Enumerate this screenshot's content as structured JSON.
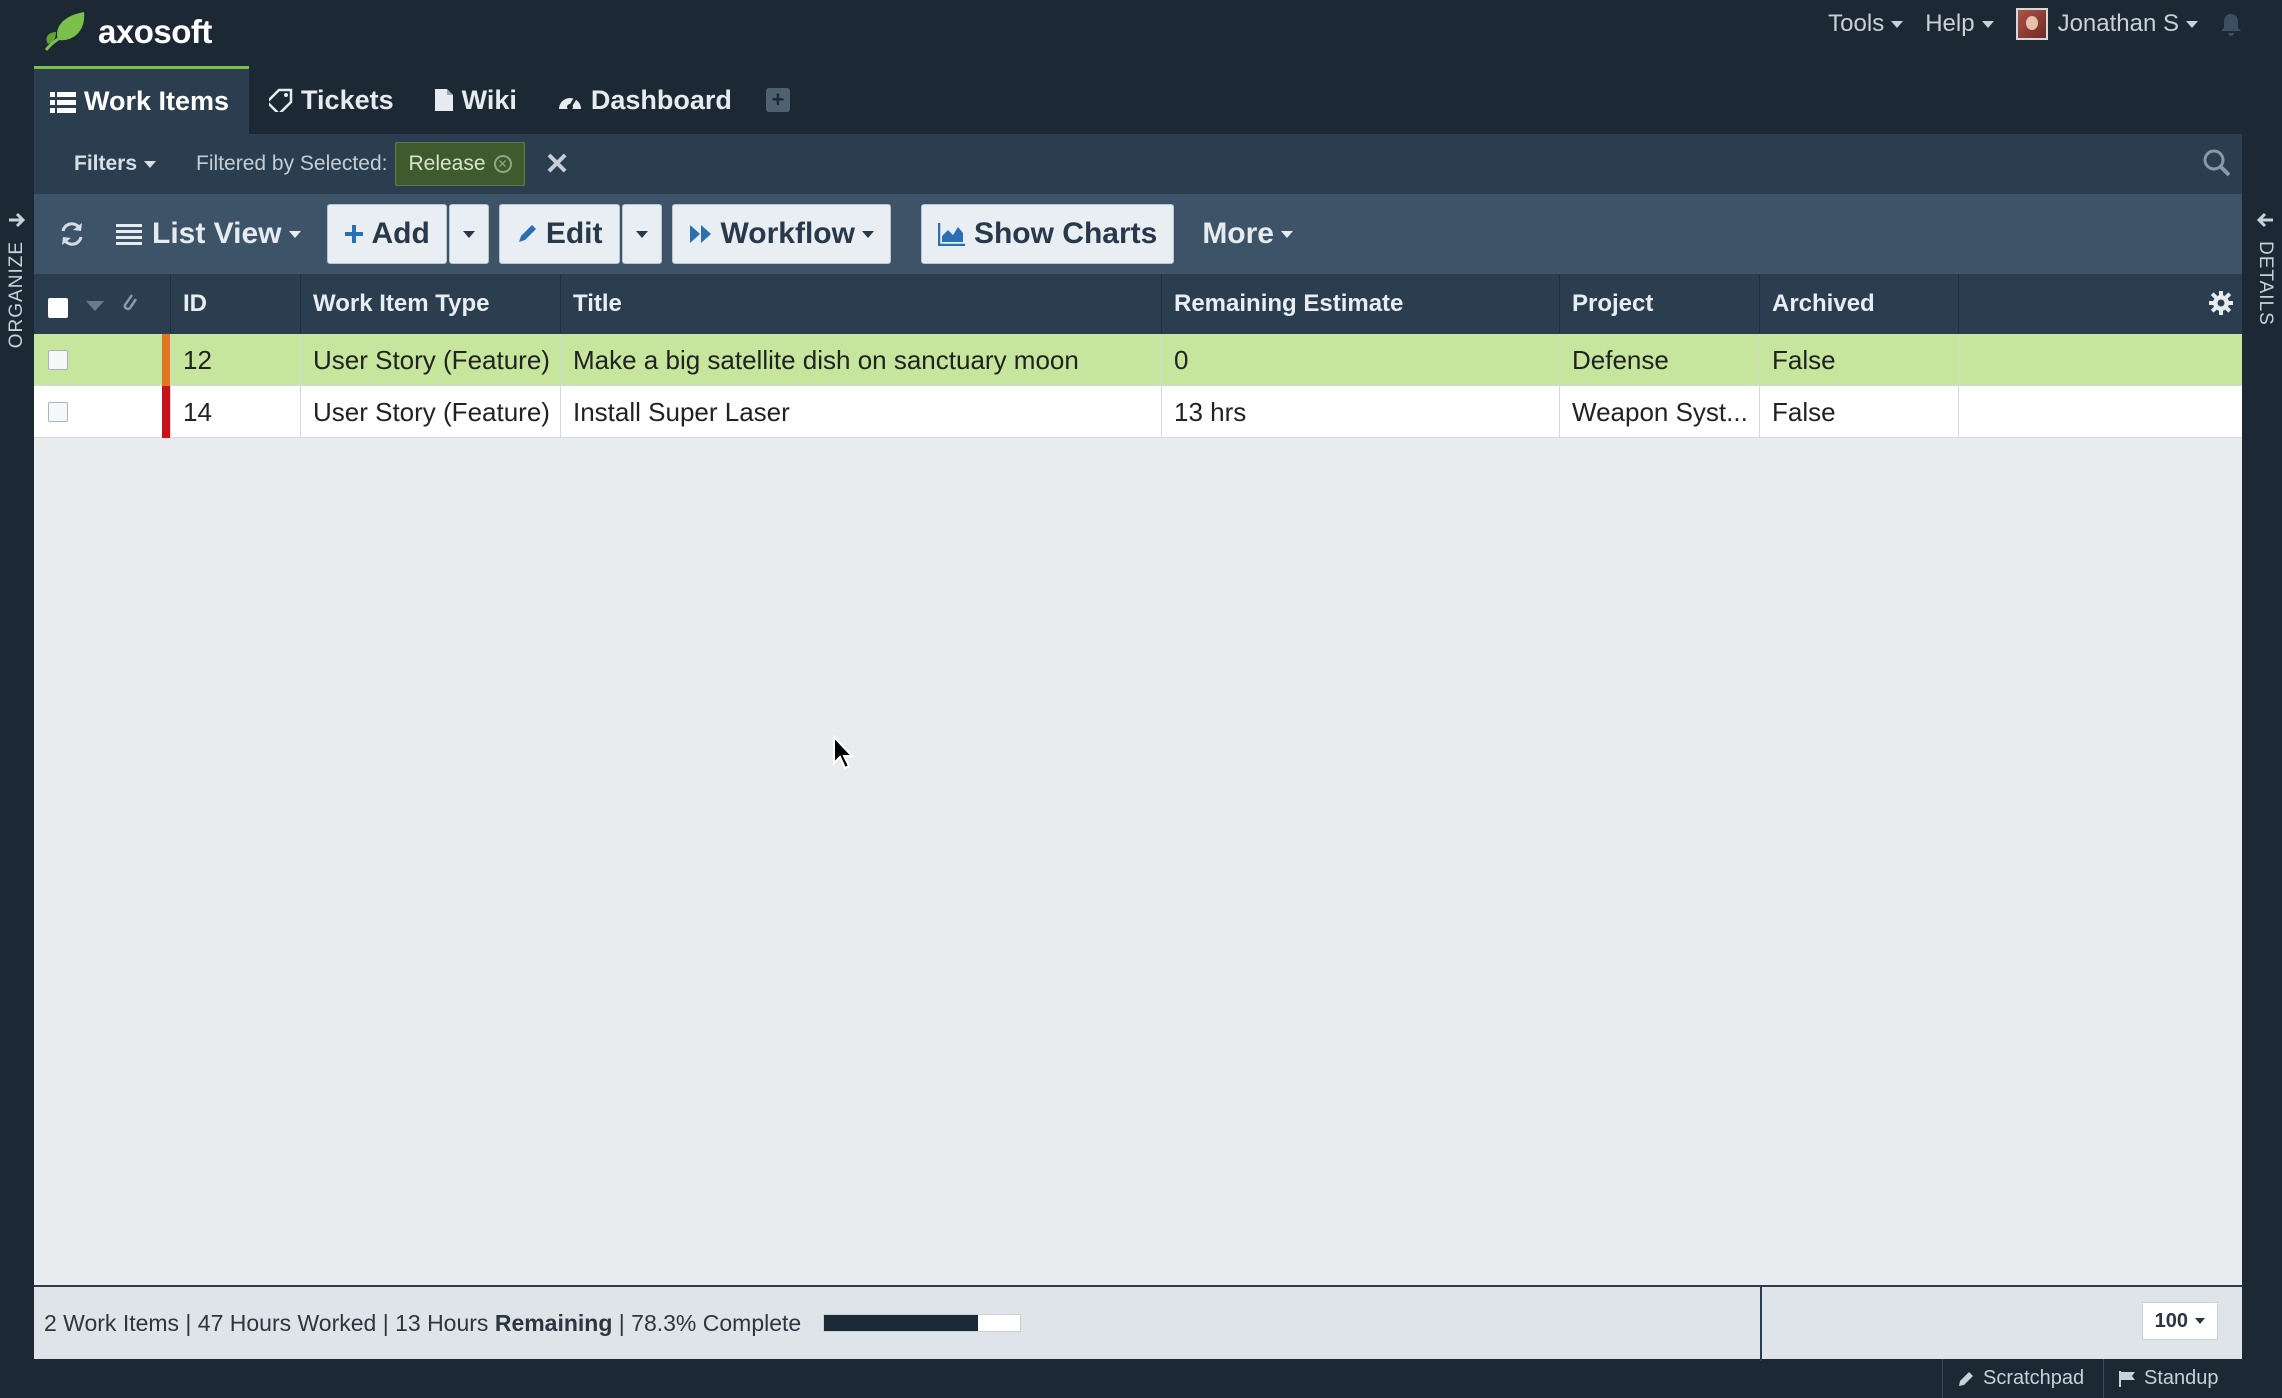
{
  "app": {
    "logo_text": "axosoft"
  },
  "top_menu": {
    "tools": "Tools",
    "help": "Help",
    "user": "Jonathan S"
  },
  "tabs": [
    {
      "label": "Work Items",
      "icon": "list-icon",
      "active": true
    },
    {
      "label": "Tickets",
      "icon": "ticket-icon",
      "active": false
    },
    {
      "label": "Wiki",
      "icon": "document-icon",
      "active": false
    },
    {
      "label": "Dashboard",
      "icon": "dashboard-icon",
      "active": false
    }
  ],
  "filter_bar": {
    "filters_label": "Filters",
    "filtered_by_label": "Filtered by Selected:",
    "chip_label": "Release"
  },
  "toolbar": {
    "list_view": "List View",
    "add": "Add",
    "edit": "Edit",
    "workflow": "Workflow",
    "show_charts": "Show Charts",
    "more": "More"
  },
  "grid": {
    "columns": [
      "ID",
      "Work Item Type",
      "Title",
      "Remaining Estimate",
      "Project",
      "Archived"
    ],
    "rows": [
      {
        "id": "12",
        "type": "User Story (Feature)",
        "title": "Make a big satellite dish on sanctuary moon",
        "remaining": "0",
        "project": "Defense",
        "archived": "False",
        "priority_color": "#e0761e",
        "selected": true
      },
      {
        "id": "14",
        "type": "User Story (Feature)",
        "title": "Install Super Laser",
        "remaining": "13 hrs",
        "project": "Weapon Syst...",
        "archived": "False",
        "priority_color": "#c6131b",
        "selected": false
      }
    ]
  },
  "status": {
    "summary_prefix": "2 Work Items | 47 Hours Worked | 13 Hours ",
    "summary_bold": "Remaining",
    "summary_suffix": " | 78.3% Complete",
    "progress_fraction": 0.783,
    "page_size": "100"
  },
  "bottom_bar": {
    "scratchpad": "Scratchpad",
    "standup": "Standup"
  },
  "rails": {
    "left": "ORGANIZE",
    "right": "DETAILS"
  },
  "colors": {
    "accent": "#7bc04a",
    "selected_row": "#c6e59d",
    "header_bg": "#2a3e50"
  }
}
